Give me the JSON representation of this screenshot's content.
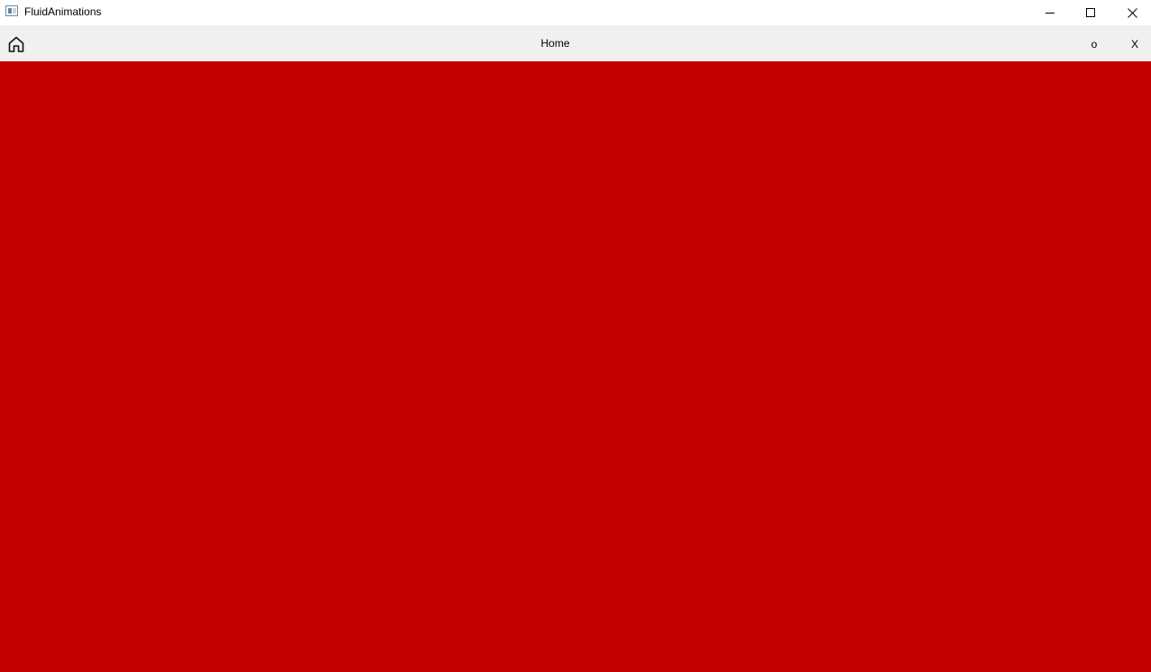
{
  "window": {
    "title": "FluidAnimations",
    "icon": "app-window-icon",
    "controls": {
      "minimize_icon": "minimize-icon",
      "maximize_icon": "maximize-icon",
      "close_icon": "close-icon"
    }
  },
  "navbar": {
    "home_icon": "home-icon",
    "title": "Home",
    "actions": {
      "o_label": "o",
      "x_label": "X"
    },
    "background_color": "#f0f0f0"
  },
  "content": {
    "background_color": "#c40000"
  }
}
